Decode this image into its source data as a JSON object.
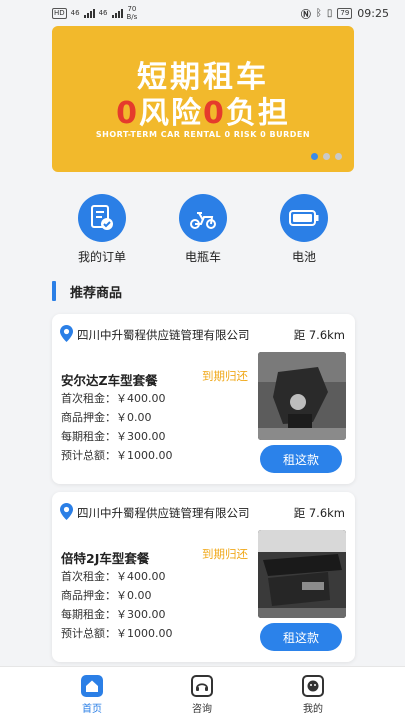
{
  "status_bar": {
    "hd": "HD",
    "signal1": "46",
    "signal2": "46",
    "speed_value": "70",
    "speed_unit": "B/s",
    "battery": "79",
    "time": "09:25"
  },
  "banner": {
    "title": "短期租车",
    "line2_parts": [
      "0",
      "风险",
      "0",
      "负担"
    ],
    "subtitle": "SHORT-TERM CAR RENTAL 0 RISK 0 BURDEN",
    "slide_count": 3,
    "active_slide": 1
  },
  "quick_menu": [
    {
      "label": "我的订单",
      "icon": "order-icon"
    },
    {
      "label": "电瓶车",
      "icon": "scooter-icon"
    },
    {
      "label": "电池",
      "icon": "battery-icon"
    }
  ],
  "section": {
    "title": "推荐商品"
  },
  "cards": [
    {
      "company": "四川中升蜀程供应链管理有限公司",
      "distance": "距 7.6km",
      "name": "安尔达Z车型套餐",
      "return_tag": "到期归还",
      "first_rent": "首次租金：￥400.00",
      "deposit": "商品押金：￥0.00",
      "period_rent": "每期租金：￥300.00",
      "total": "预计总额：￥1000.00",
      "button": "租这款"
    },
    {
      "company": "四川中升蜀程供应链管理有限公司",
      "distance": "距 7.6km",
      "name": "倍特2J车型套餐",
      "return_tag": "到期归还",
      "first_rent": "首次租金：￥400.00",
      "deposit": "商品押金：￥0.00",
      "period_rent": "每期租金：￥300.00",
      "total": "预计总额：￥1000.00",
      "button": "租这款"
    }
  ],
  "tabbar": [
    {
      "label": "首页",
      "icon": "home-icon",
      "active": true
    },
    {
      "label": "咨询",
      "icon": "headset-icon",
      "active": false
    },
    {
      "label": "我的",
      "icon": "profile-icon",
      "active": false
    }
  ],
  "colors": {
    "primary": "#2b7fe6",
    "banner": "#f2b92c",
    "banner_accent": "#e53b2c",
    "tag": "#f0a91c"
  }
}
